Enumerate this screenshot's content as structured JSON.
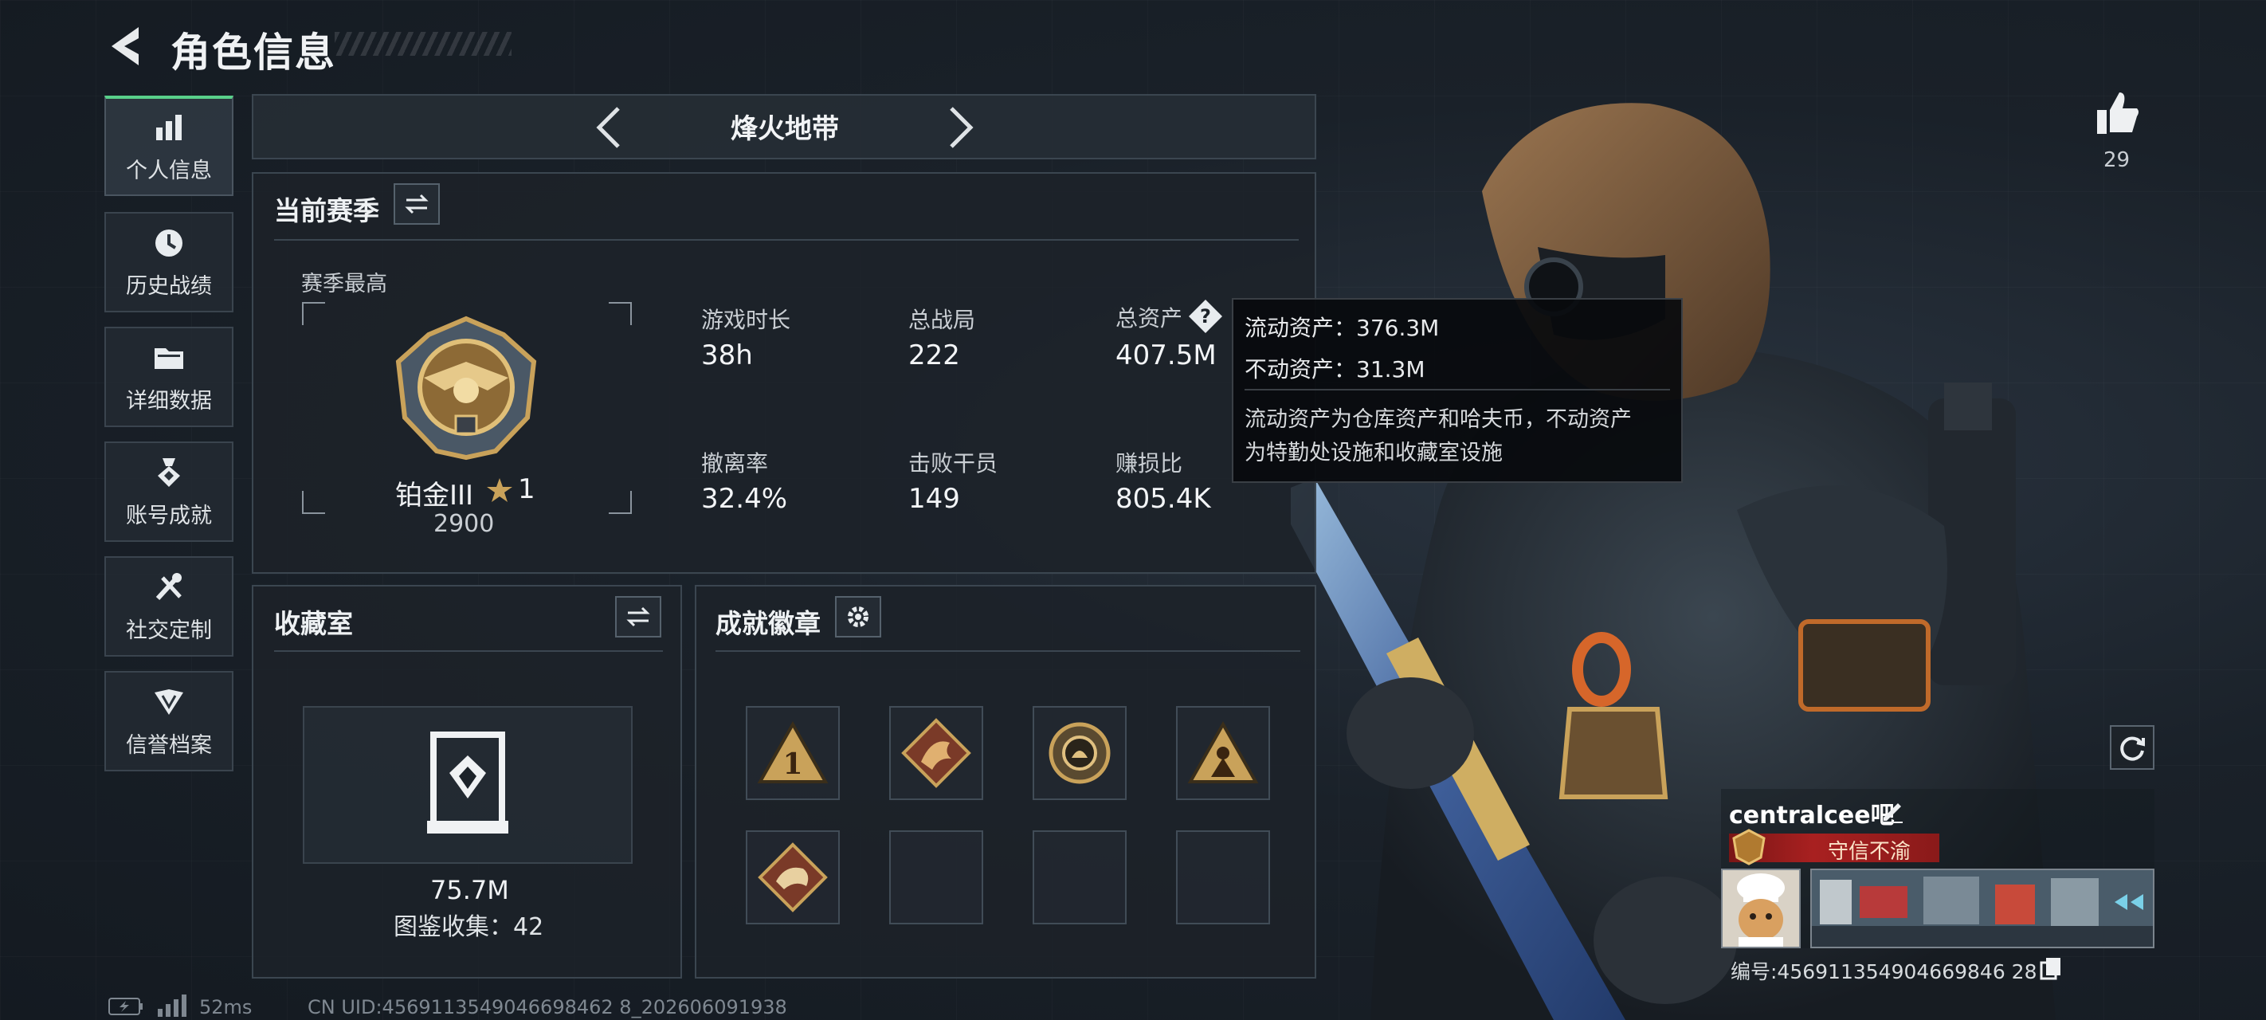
{
  "header": {
    "title": "角色信息"
  },
  "nav": {
    "items": [
      {
        "label": "个人信息",
        "icon": "bar-chart-icon",
        "active": true
      },
      {
        "label": "历史战绩",
        "icon": "clock-icon"
      },
      {
        "label": "详细数据",
        "icon": "folder-icon"
      },
      {
        "label": "账号成就",
        "icon": "medal-icon"
      },
      {
        "label": "社交定制",
        "icon": "tools-icon"
      },
      {
        "label": "信誉档案",
        "icon": "emblem-icon"
      }
    ]
  },
  "mode": {
    "label": "烽火地带"
  },
  "season": {
    "title": "当前赛季",
    "best_label": "赛季最高",
    "rank_name": "铂金III",
    "rank_stars": "1",
    "rank_points": "2900",
    "stats": [
      {
        "label": "游戏时长",
        "value": "38h"
      },
      {
        "label": "总战局",
        "value": "222"
      },
      {
        "label": "总资产",
        "value": "407.5M"
      },
      {
        "label": "撤离率",
        "value": "32.4%"
      },
      {
        "label": "击败干员",
        "value": "149"
      },
      {
        "label": "赚损比",
        "value": "805.4K"
      }
    ]
  },
  "tooltip": {
    "liquid": "流动资产：376.3M",
    "fixed": "不动资产：31.3M",
    "desc_line1": "流动资产为仓库资产和哈夫币，不动资产",
    "desc_line2": "为特勤处设施和收藏室设施"
  },
  "collection": {
    "title": "收藏室",
    "value": "75.7M",
    "count_text": "图鉴收集：42"
  },
  "badges": {
    "title": "成就徽章",
    "items": [
      "rank-one-badge",
      "dragon-badge",
      "shell-badge",
      "squad-badge",
      "beast-badge",
      "",
      "",
      ""
    ]
  },
  "likes": {
    "count": "29"
  },
  "profile": {
    "name": "centralcee吧",
    "title": "守信不渝",
    "uid_text": "编号:456911354904669846 28"
  },
  "footer": {
    "ping": "52ms",
    "cn_uid": "CN UID:4569113549046698462 8_202606091938"
  },
  "colors": {
    "accent_green": "#59d08a",
    "banner_red": "#a82020",
    "gold": "#c9a25a"
  }
}
